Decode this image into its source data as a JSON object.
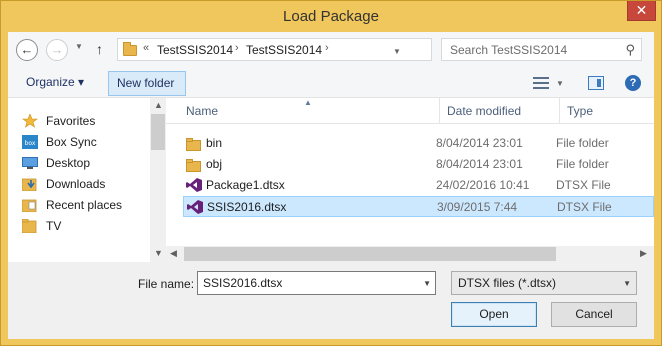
{
  "window": {
    "title": "Load Package",
    "close_symbol": "✕"
  },
  "address": {
    "breadcrumbs": [
      "«",
      "TestSSIS2014",
      "›",
      "TestSSIS2014",
      "›"
    ],
    "search_placeholder": "Search TestSSIS2014"
  },
  "toolbar": {
    "organize_label": "Organize ▾",
    "new_folder_label": "New folder"
  },
  "navpane": {
    "items": [
      {
        "label": "Favorites",
        "icon": "star-icon"
      },
      {
        "label": "Box Sync",
        "icon": "box-icon"
      },
      {
        "label": "Desktop",
        "icon": "desktop-icon"
      },
      {
        "label": "Downloads",
        "icon": "downloads-icon"
      },
      {
        "label": "Recent places",
        "icon": "recent-places-icon"
      },
      {
        "label": "TV",
        "icon": "folder-icon"
      }
    ]
  },
  "files": {
    "columns": [
      "Name",
      "Date modified",
      "Type"
    ],
    "rows": [
      {
        "name": "bin",
        "date": "8/04/2014 23:01",
        "type": "File folder",
        "icon": "folder-icon"
      },
      {
        "name": "obj",
        "date": "8/04/2014 23:01",
        "type": "File folder",
        "icon": "folder-icon"
      },
      {
        "name": "Package1.dtsx",
        "date": "24/02/2016 10:41",
        "type": "DTSX File",
        "icon": "visual-studio-icon"
      },
      {
        "name": "SSIS2016.dtsx",
        "date": "3/09/2015 7:44",
        "type": "DTSX File",
        "icon": "visual-studio-icon"
      }
    ]
  },
  "footer": {
    "file_name_label": "File name:",
    "file_name_value": "SSIS2016.dtsx",
    "filter_value": "DTSX files (*.dtsx)",
    "open_label": "Open",
    "cancel_label": "Cancel"
  },
  "colors": {
    "frame": "#f0c75d",
    "selection": "#cce8ff",
    "close": "#c7483b"
  }
}
